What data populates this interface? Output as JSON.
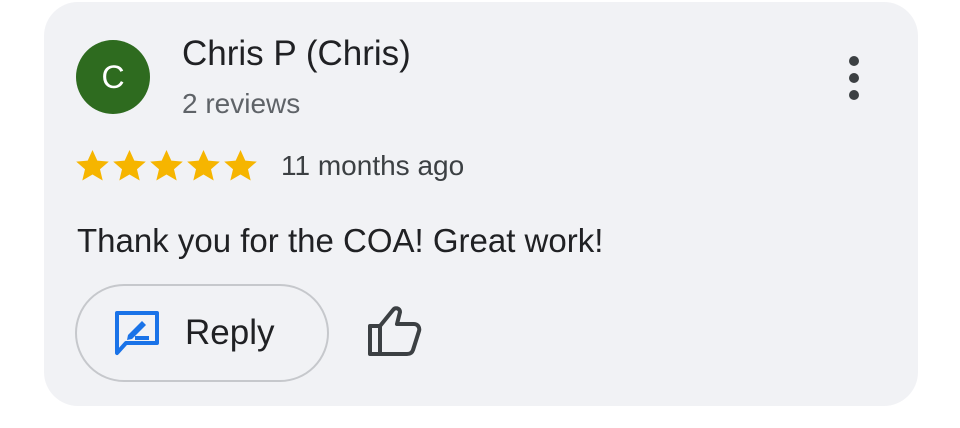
{
  "review": {
    "avatar_letter": "C",
    "avatar_color": "#2e6b1f",
    "author_name": "Chris P (Chris)",
    "review_count": "2 reviews",
    "rating": 5,
    "rating_max": 5,
    "star_color": "#f6b500",
    "date": "11 months ago",
    "text": "Thank you for the COA! Great work!"
  },
  "actions": {
    "reply_label": "Reply",
    "reply_icon": "rate-review-icon",
    "reply_icon_color": "#1a73e8",
    "like_icon": "thumb-up-outline-icon",
    "more_icon": "more-vertical-icon"
  }
}
